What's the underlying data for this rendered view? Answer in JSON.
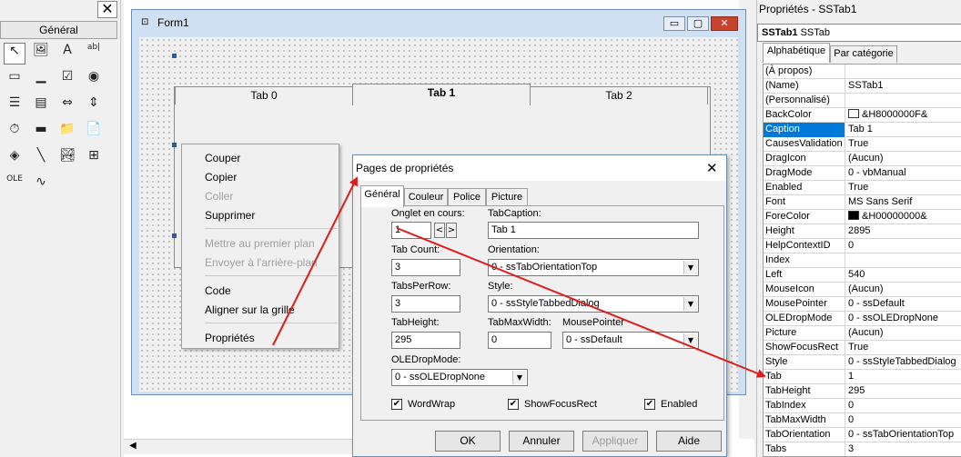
{
  "toolbox": {
    "general_label": "Général",
    "close_glyph": "✕",
    "tools": [
      {
        "name": "pointer-icon",
        "glyph": "↖"
      },
      {
        "name": "picturebox-icon",
        "glyph": "🖼"
      },
      {
        "name": "label-icon",
        "glyph": "A"
      },
      {
        "name": "textbox-icon",
        "glyph": "ab|"
      },
      {
        "name": "frame-icon",
        "glyph": "▭"
      },
      {
        "name": "commandbutton-icon",
        "glyph": "▁"
      },
      {
        "name": "checkbox-icon",
        "glyph": "☑"
      },
      {
        "name": "optionbutton-icon",
        "glyph": "◉"
      },
      {
        "name": "combobox-icon",
        "glyph": "☰"
      },
      {
        "name": "listbox-icon",
        "glyph": "▤"
      },
      {
        "name": "hscrollbar-icon",
        "glyph": "⇔"
      },
      {
        "name": "vscrollbar-icon",
        "glyph": "⇕"
      },
      {
        "name": "timer-icon",
        "glyph": "⏱"
      },
      {
        "name": "drivelistbox-icon",
        "glyph": "▬"
      },
      {
        "name": "dirlistbox-icon",
        "glyph": "📁"
      },
      {
        "name": "filelistbox-icon",
        "glyph": "📄"
      },
      {
        "name": "shape-icon",
        "glyph": "◈"
      },
      {
        "name": "line-icon",
        "glyph": "╲"
      },
      {
        "name": "image-icon",
        "glyph": "🏞"
      },
      {
        "name": "data-icon",
        "glyph": "⊞"
      },
      {
        "name": "ole-icon",
        "glyph": "OLE"
      },
      {
        "name": "sstab-icon",
        "glyph": "∿"
      }
    ]
  },
  "form": {
    "title": "Form1",
    "minimize_glyph": "▭",
    "maximize_glyph": "▢",
    "close_glyph": "✕",
    "tabs": [
      "Tab 0",
      "Tab 1",
      "Tab 2"
    ]
  },
  "context_menu": {
    "items": [
      {
        "label": "Couper",
        "disabled": false
      },
      {
        "label": "Copier",
        "disabled": false
      },
      {
        "label": "Coller",
        "disabled": true
      },
      {
        "label": "Supprimer",
        "disabled": false
      },
      {
        "label": "Mettre au premier plan",
        "disabled": true
      },
      {
        "label": "Envoyer à l'arrière-plan",
        "disabled": true
      },
      {
        "label": "Code",
        "disabled": false
      },
      {
        "label": "Aligner sur la grille",
        "disabled": false
      },
      {
        "label": "Propriétés",
        "disabled": false
      }
    ]
  },
  "dialog": {
    "title": "Pages de propriétés",
    "close_glyph": "✕",
    "tabs": [
      "Général",
      "Couleur",
      "Police",
      "Picture"
    ],
    "fields": {
      "current_tab_label": "Onglet en cours:",
      "current_tab_value": "1",
      "spin_left": "<",
      "spin_right": ">",
      "tab_caption_label": "TabCaption:",
      "tab_caption_value": "Tab 1",
      "tab_count_label": "Tab Count:",
      "tab_count_value": "3",
      "orientation_label": "Orientation:",
      "orientation_value": "0 - ssTabOrientationTop",
      "tabs_per_row_label": "TabsPerRow:",
      "tabs_per_row_value": "3",
      "style_label": "Style:",
      "style_value": "0 - ssStyleTabbedDialog",
      "tab_height_label": "TabHeight:",
      "tab_height_value": "295",
      "tab_max_width_label": "TabMaxWidth:",
      "tab_max_width_value": "0",
      "mouse_pointer_label": "MousePointer",
      "mouse_pointer_value": "0 - ssDefault",
      "ole_drop_mode_label": "OLEDropMode:",
      "ole_drop_mode_value": "0 - ssOLEDropNone",
      "dropdown_glyph": "▼"
    },
    "checkboxes": [
      {
        "label": "WordWrap",
        "checked": true
      },
      {
        "label": "ShowFocusRect",
        "checked": true
      },
      {
        "label": "Enabled",
        "checked": true
      }
    ],
    "check_glyph": "✔",
    "buttons": {
      "ok": "OK",
      "cancel": "Annuler",
      "apply": "Appliquer",
      "help": "Aide"
    }
  },
  "properties": {
    "title": "Propriétés - SSTab1",
    "object_name": "SSTab1",
    "object_type": "SSTab",
    "tabs": [
      "Alphabétique",
      "Par catégorie"
    ],
    "rows": [
      {
        "name": "(À propos)",
        "value": ""
      },
      {
        "name": "(Name)",
        "value": "SSTab1"
      },
      {
        "name": "(Personnalisé)",
        "value": ""
      },
      {
        "name": "BackColor",
        "value": "&H8000000F&",
        "swatch": "#ffffff"
      },
      {
        "name": "Caption",
        "value": "Tab 1",
        "selected": true
      },
      {
        "name": "CausesValidation",
        "value": "True"
      },
      {
        "name": "DragIcon",
        "value": "(Aucun)"
      },
      {
        "name": "DragMode",
        "value": "0 - vbManual"
      },
      {
        "name": "Enabled",
        "value": "True"
      },
      {
        "name": "Font",
        "value": "MS Sans Serif"
      },
      {
        "name": "ForeColor",
        "value": "&H00000000&",
        "swatch": "#000000"
      },
      {
        "name": "Height",
        "value": "2895"
      },
      {
        "name": "HelpContextID",
        "value": "0"
      },
      {
        "name": "Index",
        "value": ""
      },
      {
        "name": "Left",
        "value": "540"
      },
      {
        "name": "MouseIcon",
        "value": "(Aucun)"
      },
      {
        "name": "MousePointer",
        "value": "0 - ssDefault"
      },
      {
        "name": "OLEDropMode",
        "value": "0 - ssOLEDropNone"
      },
      {
        "name": "Picture",
        "value": "(Aucun)"
      },
      {
        "name": "ShowFocusRect",
        "value": "True"
      },
      {
        "name": "Style",
        "value": "0 - ssStyleTabbedDialog"
      },
      {
        "name": "Tab",
        "value": "1"
      },
      {
        "name": "TabHeight",
        "value": "295"
      },
      {
        "name": "TabIndex",
        "value": "0"
      },
      {
        "name": "TabMaxWidth",
        "value": "0"
      },
      {
        "name": "TabOrientation",
        "value": "0 - ssTabOrientationTop"
      },
      {
        "name": "Tabs",
        "value": "3"
      }
    ]
  },
  "colors": {
    "annotation_arrow": "#e01b1b",
    "selection": "#0078d7",
    "form_border": "#6d8fb5"
  }
}
